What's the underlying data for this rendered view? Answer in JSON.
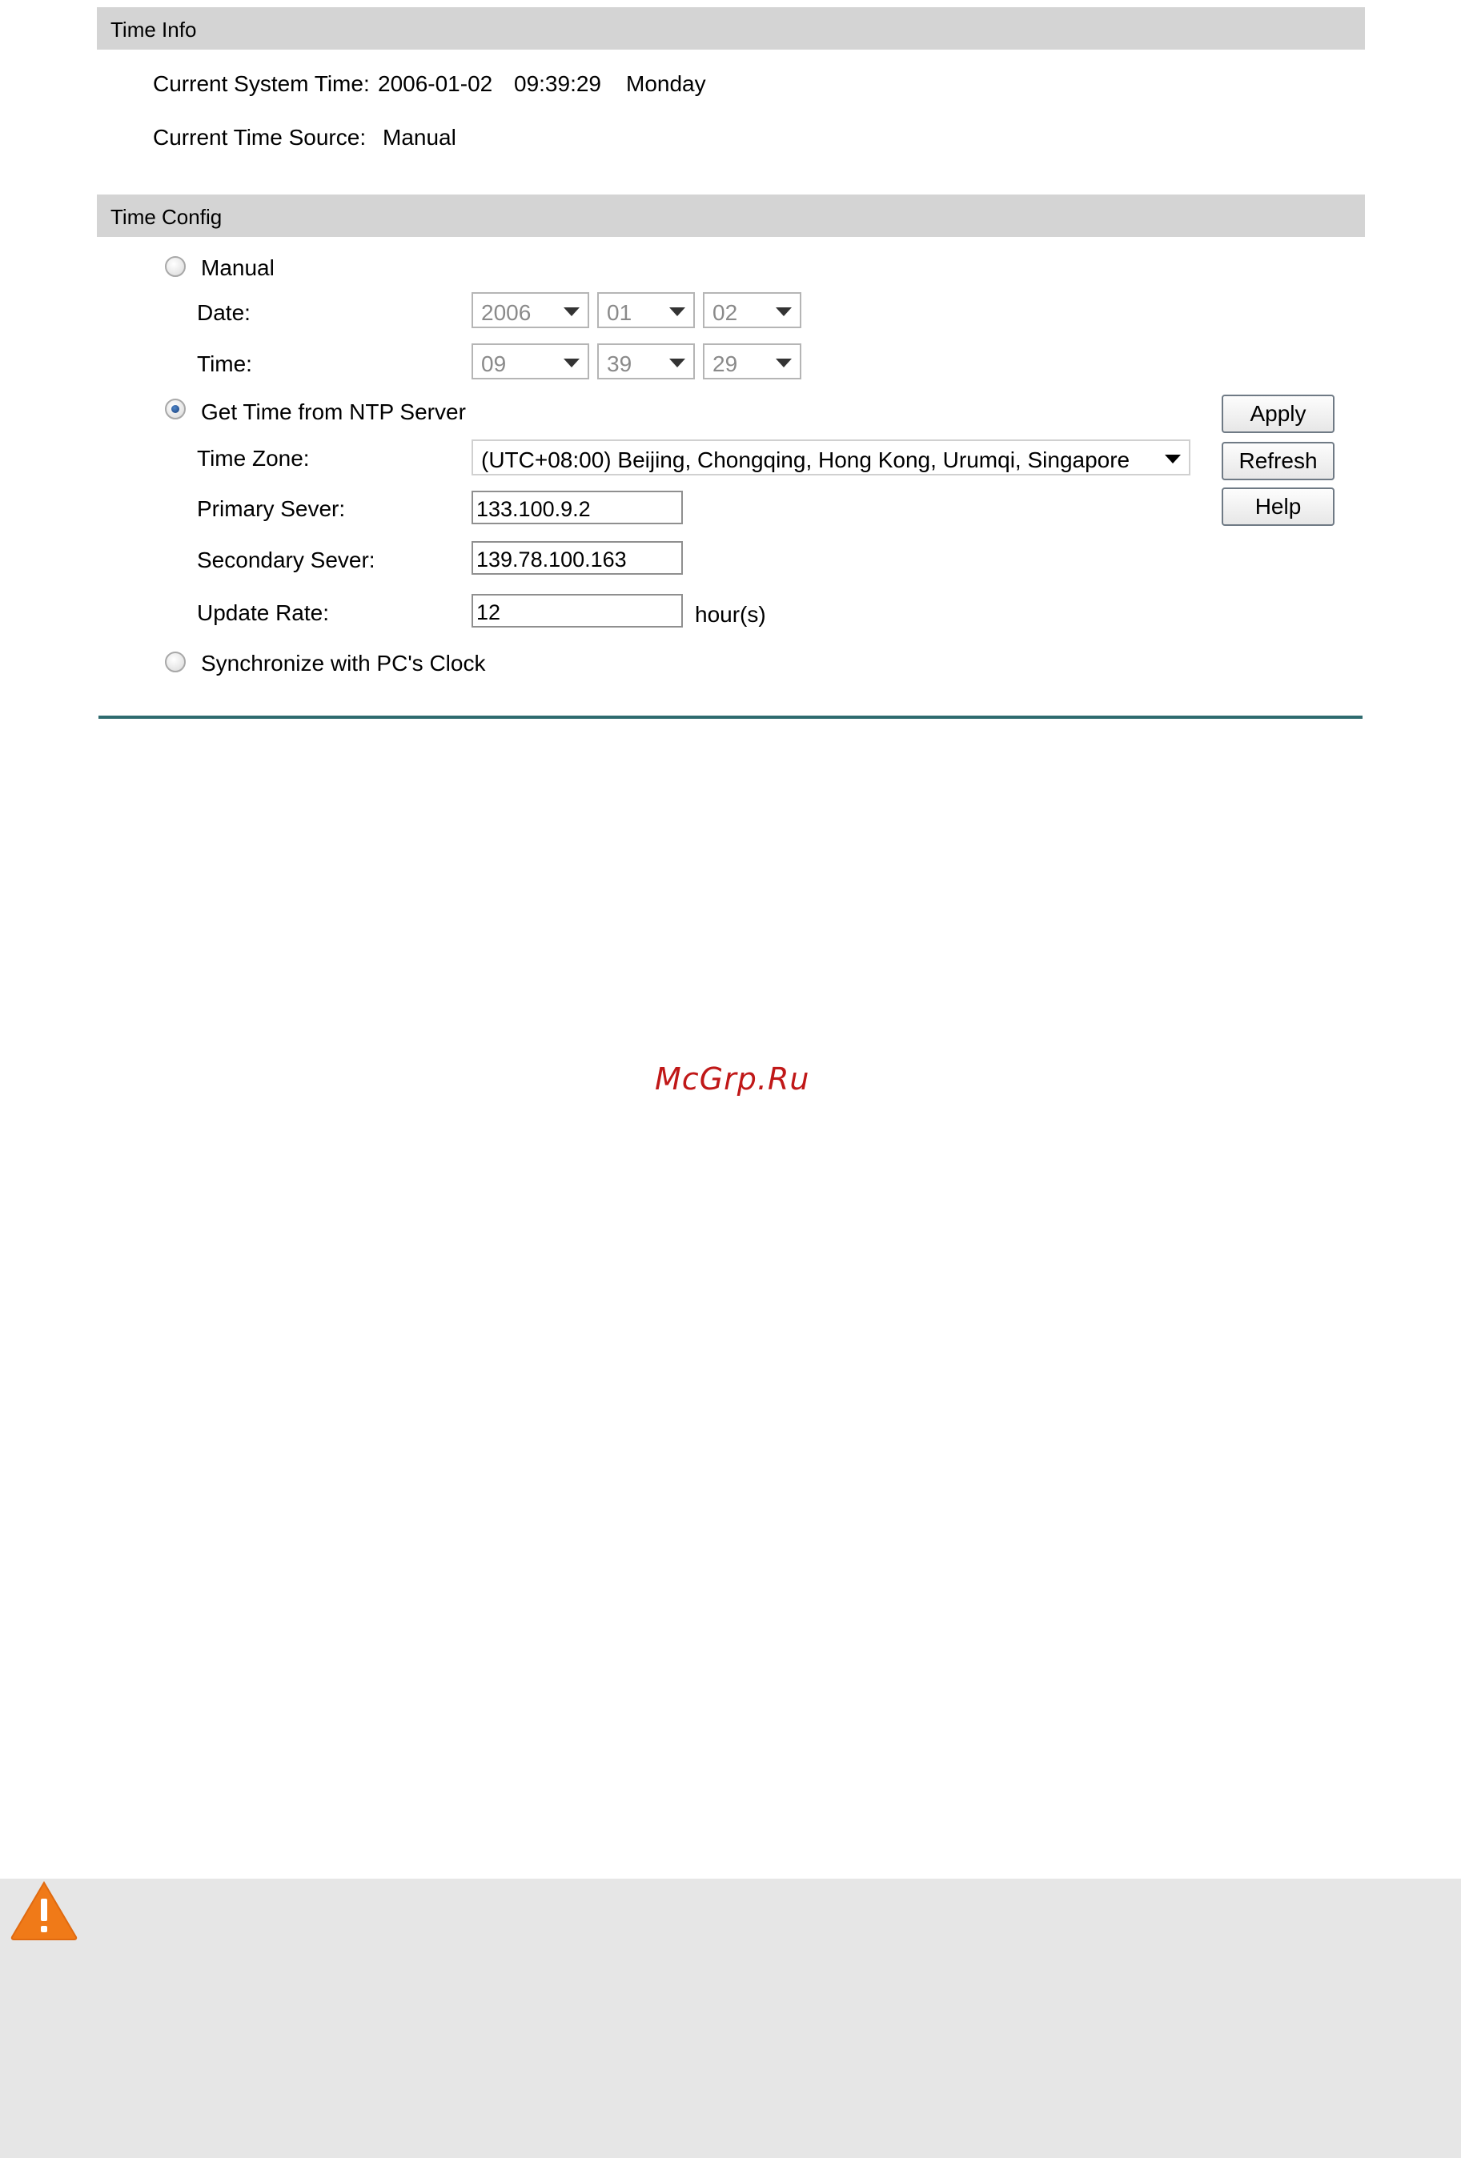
{
  "time_info": {
    "header": "Time Info",
    "system_time_label": "Current System Time:",
    "system_date": "2006-01-02",
    "system_clock": "09:39:29",
    "system_day": "Monday",
    "source_label": "Current Time Source:",
    "source_value": "Manual"
  },
  "time_config": {
    "header": "Time Config",
    "manual": {
      "label": "Manual",
      "selected": false,
      "date_label": "Date:",
      "year": "2006",
      "month": "01",
      "day": "02",
      "time_label": "Time:",
      "hour": "09",
      "minute": "39",
      "second": "29"
    },
    "ntp": {
      "label": "Get Time from NTP Server",
      "selected": true,
      "timezone_label": "Time Zone:",
      "timezone_value": "(UTC+08:00) Beijing, Chongqing, Hong Kong, Urumqi, Singapore",
      "primary_label": "Primary Sever:",
      "primary_value": "133.100.9.2",
      "secondary_label": "Secondary Sever:",
      "secondary_value": "139.78.100.163",
      "update_label": "Update Rate:",
      "update_value": "12",
      "update_unit": "hour(s)"
    },
    "pc_clock": {
      "label": "Synchronize with PC's Clock",
      "selected": false
    }
  },
  "buttons": {
    "apply": "Apply",
    "refresh": "Refresh",
    "help": "Help"
  },
  "watermark": "McGrp.Ru",
  "icons": {
    "warning": "warning-icon"
  },
  "colors": {
    "section_bar": "#d4d4d4",
    "divider": "#2f6b6f",
    "warning": "#f07a18",
    "watermark": "#c01818",
    "note_background": "#e6e6e6"
  }
}
